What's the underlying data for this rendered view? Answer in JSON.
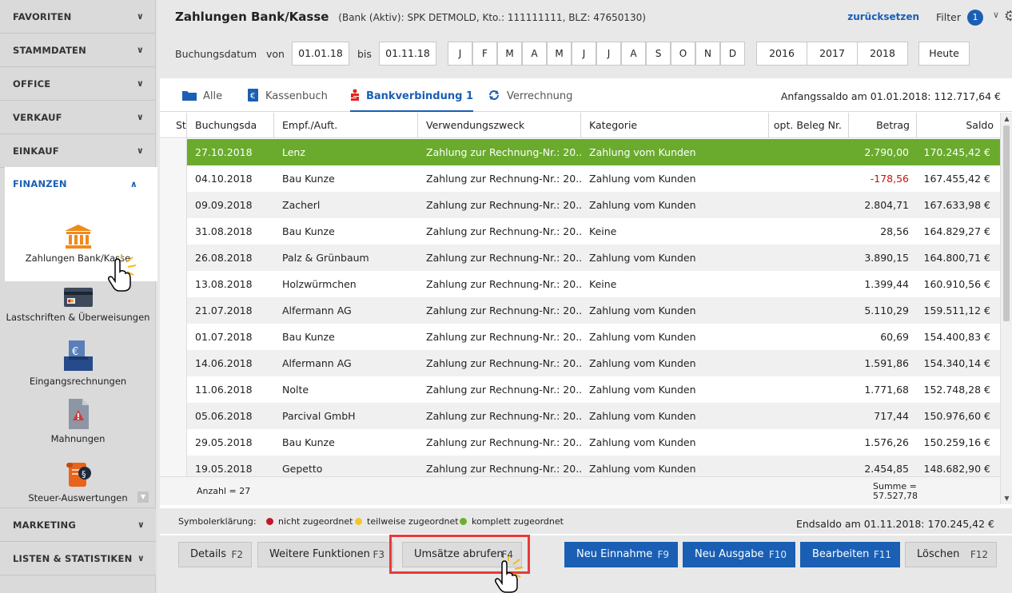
{
  "sidebar": {
    "sections": [
      {
        "label": "FAVORITEN"
      },
      {
        "label": "STAMMDATEN"
      },
      {
        "label": "OFFICE"
      },
      {
        "label": "VERKAUF"
      },
      {
        "label": "EINKAUF"
      }
    ],
    "expanded": {
      "label": "FINANZEN"
    },
    "sub_items": [
      {
        "label": "Zahlungen Bank/Kasse",
        "icon": "bank-icon"
      },
      {
        "label": "Lastschriften & Überweisungen",
        "icon": "credit-card-icon"
      },
      {
        "label": "Eingangsrechnungen",
        "icon": "incoming-invoice-icon"
      },
      {
        "label": "Mahnungen",
        "icon": "reminder-icon"
      },
      {
        "label": "Steuer-Auswertungen",
        "icon": "tax-report-icon"
      }
    ],
    "bottom_sections": [
      {
        "label": "MARKETING"
      },
      {
        "label": "LISTEN & STATISTIKEN"
      }
    ]
  },
  "header": {
    "title": "Zahlungen Bank/Kasse",
    "subtitle": "(Bank (Aktiv): SPK DETMOLD, Kto.: 111111111, BLZ: 47650130)",
    "reset_label": "zurücksetzen",
    "filter_label": "Filter",
    "filter_count": "1"
  },
  "date_filter": {
    "label": "Buchungsdatum",
    "from_label": "von",
    "from_value": "01.01.18",
    "to_label": "bis",
    "to_value": "01.11.18",
    "months": [
      "J",
      "F",
      "M",
      "A",
      "M",
      "J",
      "J",
      "A",
      "S",
      "O",
      "N",
      "D"
    ],
    "years": [
      "2016",
      "2017",
      "2018"
    ],
    "today_label": "Heute"
  },
  "tabs": [
    {
      "label": "Alle",
      "icon": "folder-icon",
      "active": false
    },
    {
      "label": "Kassenbuch",
      "icon": "cashbook-icon",
      "active": false
    },
    {
      "label": "Bankverbindung 1",
      "icon": "sparkasse-icon",
      "active": true
    },
    {
      "label": "Verrechnung",
      "icon": "settlement-icon",
      "active": false
    }
  ],
  "opening_balance": "Anfangssaldo am 01.01.2018: 112.717,64 €",
  "table": {
    "columns": [
      "St",
      "Buchungsda",
      "Empf./Auft.",
      "Verwendungszweck",
      "Kategorie",
      "opt. Beleg Nr.",
      "Betrag",
      "Saldo"
    ],
    "rows": [
      {
        "date": "27.10.2018",
        "party": "Lenz",
        "purpose": "Zahlung zur Rechnung-Nr.: 20...",
        "category": "Zahlung vom Kunden",
        "receipt": "",
        "amount": "2.790,00",
        "balance": "170.245,42 €",
        "negative": false,
        "selected": true
      },
      {
        "date": "04.10.2018",
        "party": "Bau Kunze",
        "purpose": "Zahlung zur Rechnung-Nr.: 20...",
        "category": "Zahlung vom Kunden",
        "receipt": "",
        "amount": "-178,56",
        "balance": "167.455,42 €",
        "negative": true,
        "selected": false
      },
      {
        "date": "09.09.2018",
        "party": "Zacherl",
        "purpose": "Zahlung zur Rechnung-Nr.: 20...",
        "category": "Zahlung vom Kunden",
        "receipt": "",
        "amount": "2.804,71",
        "balance": "167.633,98 €",
        "negative": false,
        "selected": false
      },
      {
        "date": "31.08.2018",
        "party": "Bau Kunze",
        "purpose": "Zahlung zur Rechnung-Nr.: 20...",
        "category": "Keine",
        "receipt": "",
        "amount": "28,56",
        "balance": "164.829,27 €",
        "negative": false,
        "selected": false
      },
      {
        "date": "26.08.2018",
        "party": "Palz & Grünbaum",
        "purpose": "Zahlung zur Rechnung-Nr.: 20...",
        "category": "Zahlung vom Kunden",
        "receipt": "",
        "amount": "3.890,15",
        "balance": "164.800,71 €",
        "negative": false,
        "selected": false
      },
      {
        "date": "13.08.2018",
        "party": "Holzwürmchen",
        "purpose": "Zahlung zur Rechnung-Nr.: 20...",
        "category": "Keine",
        "receipt": "",
        "amount": "1.399,44",
        "balance": "160.910,56 €",
        "negative": false,
        "selected": false
      },
      {
        "date": "21.07.2018",
        "party": "Alfermann AG",
        "purpose": "Zahlung zur Rechnung-Nr.: 20...",
        "category": "Zahlung vom Kunden",
        "receipt": "",
        "amount": "5.110,29",
        "balance": "159.511,12 €",
        "negative": false,
        "selected": false
      },
      {
        "date": "01.07.2018",
        "party": "Bau Kunze",
        "purpose": "Zahlung zur Rechnung-Nr.: 20...",
        "category": "Zahlung vom Kunden",
        "receipt": "",
        "amount": "60,69",
        "balance": "154.400,83 €",
        "negative": false,
        "selected": false
      },
      {
        "date": "14.06.2018",
        "party": "Alfermann AG",
        "purpose": "Zahlung zur Rechnung-Nr.: 20...",
        "category": "Zahlung vom Kunden",
        "receipt": "",
        "amount": "1.591,86",
        "balance": "154.340,14 €",
        "negative": false,
        "selected": false
      },
      {
        "date": "11.06.2018",
        "party": "Nolte",
        "purpose": "Zahlung zur Rechnung-Nr.: 20...",
        "category": "Zahlung vom Kunden",
        "receipt": "",
        "amount": "1.771,68",
        "balance": "152.748,28 €",
        "negative": false,
        "selected": false
      },
      {
        "date": "05.06.2018",
        "party": "Parcival GmbH",
        "purpose": "Zahlung zur Rechnung-Nr.: 20...",
        "category": "Zahlung vom Kunden",
        "receipt": "",
        "amount": "717,44",
        "balance": "150.976,60 €",
        "negative": false,
        "selected": false
      },
      {
        "date": "29.05.2018",
        "party": "Bau Kunze",
        "purpose": "Zahlung zur Rechnung-Nr.: 20...",
        "category": "Zahlung vom Kunden",
        "receipt": "",
        "amount": "1.576,26",
        "balance": "150.259,16 €",
        "negative": false,
        "selected": false
      },
      {
        "date": "19.05.2018",
        "party": "Gepetto",
        "purpose": "Zahlung zur Rechnung-Nr.: 20...",
        "category": "Zahlung vom Kunden",
        "receipt": "",
        "amount": "2.454,85",
        "balance": "148.682,90 €",
        "negative": false,
        "selected": false
      }
    ],
    "count_label": "Anzahl = 27",
    "sum_label": "Summe =",
    "sum_value": "57.527,78"
  },
  "legend": {
    "title": "Symbolerklärung:",
    "items": [
      {
        "label": "nicht zugeordnet",
        "color": "#c0182a"
      },
      {
        "label": "teilweise zugeordnet",
        "color": "#f2c62a"
      },
      {
        "label": "komplett zugeordnet",
        "color": "#6ab02e"
      }
    ]
  },
  "closing_balance": "Endsaldo am 01.11.2018: 170.245,42 €",
  "buttons": [
    {
      "label": "Details",
      "key": "F2",
      "primary": false
    },
    {
      "label": "Weitere Funktionen",
      "key": "F3",
      "primary": false
    },
    {
      "label": "Umsätze abrufen",
      "key": "F4",
      "primary": false
    },
    {
      "label": "Neu Einnahme",
      "key": "F9",
      "primary": true
    },
    {
      "label": "Neu Ausgabe",
      "key": "F10",
      "primary": true
    },
    {
      "label": "Bearbeiten",
      "key": "F11",
      "primary": true
    },
    {
      "label": "Löschen",
      "key": "F12",
      "primary": false
    }
  ],
  "colors": {
    "accent": "#1a5fb4",
    "selected_row": "#6aab2e",
    "negative": "#d01010",
    "highlight": "#e83a3a"
  }
}
